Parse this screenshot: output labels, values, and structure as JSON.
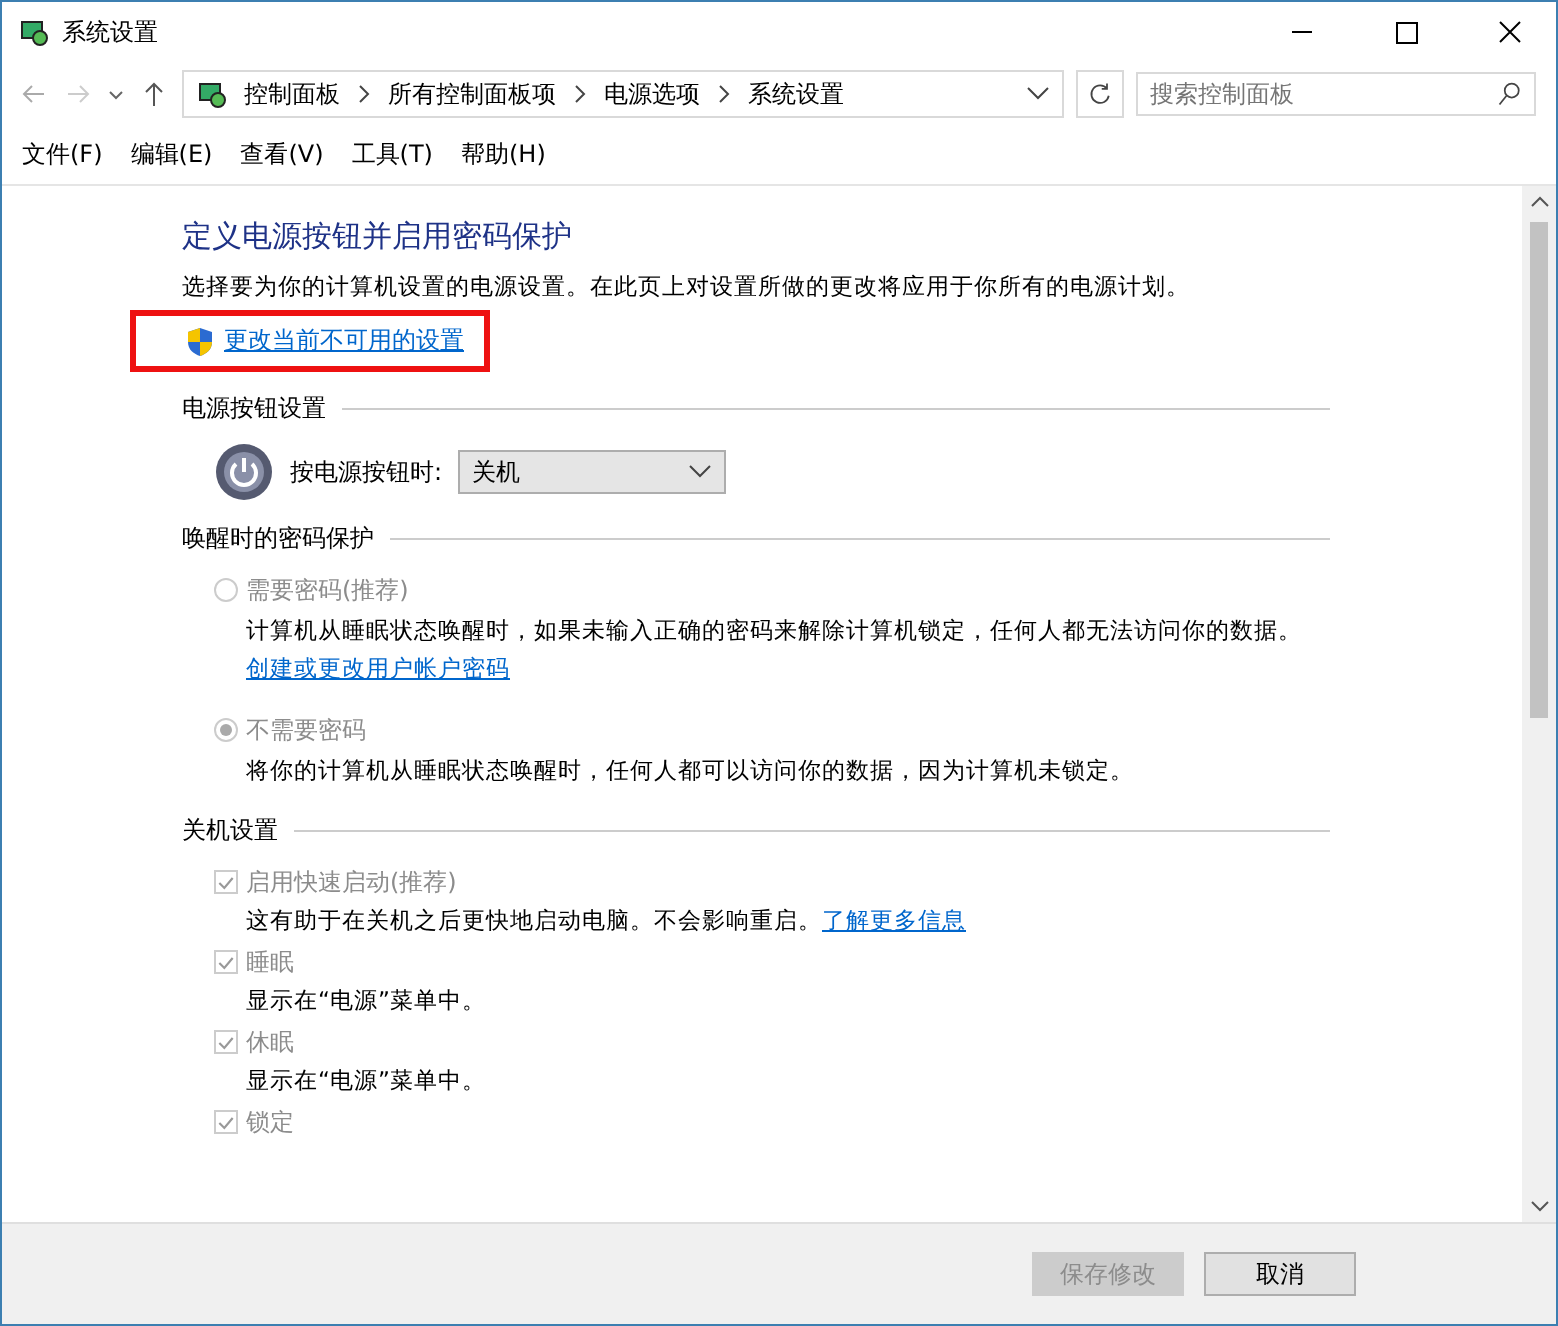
{
  "window": {
    "title": "系统设置"
  },
  "address": {
    "crumbs": [
      "控制面板",
      "所有控制面板项",
      "电源选项",
      "系统设置"
    ],
    "search_placeholder": "搜索控制面板"
  },
  "menu": [
    "文件(F)",
    "编辑(E)",
    "查看(V)",
    "工具(T)",
    "帮助(H)"
  ],
  "heading": "定义电源按钮并启用密码保护",
  "intro": "选择要为你的计算机设置的电源设置。在此页上对设置所做的更改将应用于你所有的电源计划。",
  "admin_link": "更改当前不可用的设置",
  "power_section": {
    "title": "电源按钮设置",
    "label": "按电源按钮时:",
    "value": "关机"
  },
  "password_section": {
    "title": "唤醒时的密码保护",
    "options": [
      {
        "label": "需要密码(推荐)",
        "selected": false,
        "description": "计算机从睡眠状态唤醒时，如果未输入正确的密码来解除计算机锁定，任何人都无法访问你的数据。",
        "link": "创建或更改用户帐户密码"
      },
      {
        "label": "不需要密码",
        "selected": true,
        "description": "将你的计算机从睡眠状态唤醒时，任何人都可以访问你的数据，因为计算机未锁定。"
      }
    ]
  },
  "shutdown_section": {
    "title": "关机设置",
    "items": [
      {
        "label": "启用快速启动(推荐)",
        "checked": true,
        "description": "这有助于在关机之后更快地启动电脑。不会影响重启。",
        "link": "了解更多信息"
      },
      {
        "label": "睡眠",
        "checked": true,
        "description": "显示在“电源”菜单中。"
      },
      {
        "label": "休眠",
        "checked": true,
        "description": "显示在“电源”菜单中。"
      },
      {
        "label": "锁定",
        "checked": true
      }
    ]
  },
  "buttons": [
    {
      "label": "保存修改",
      "disabled": true
    },
    {
      "label": "取消",
      "disabled": false
    }
  ]
}
